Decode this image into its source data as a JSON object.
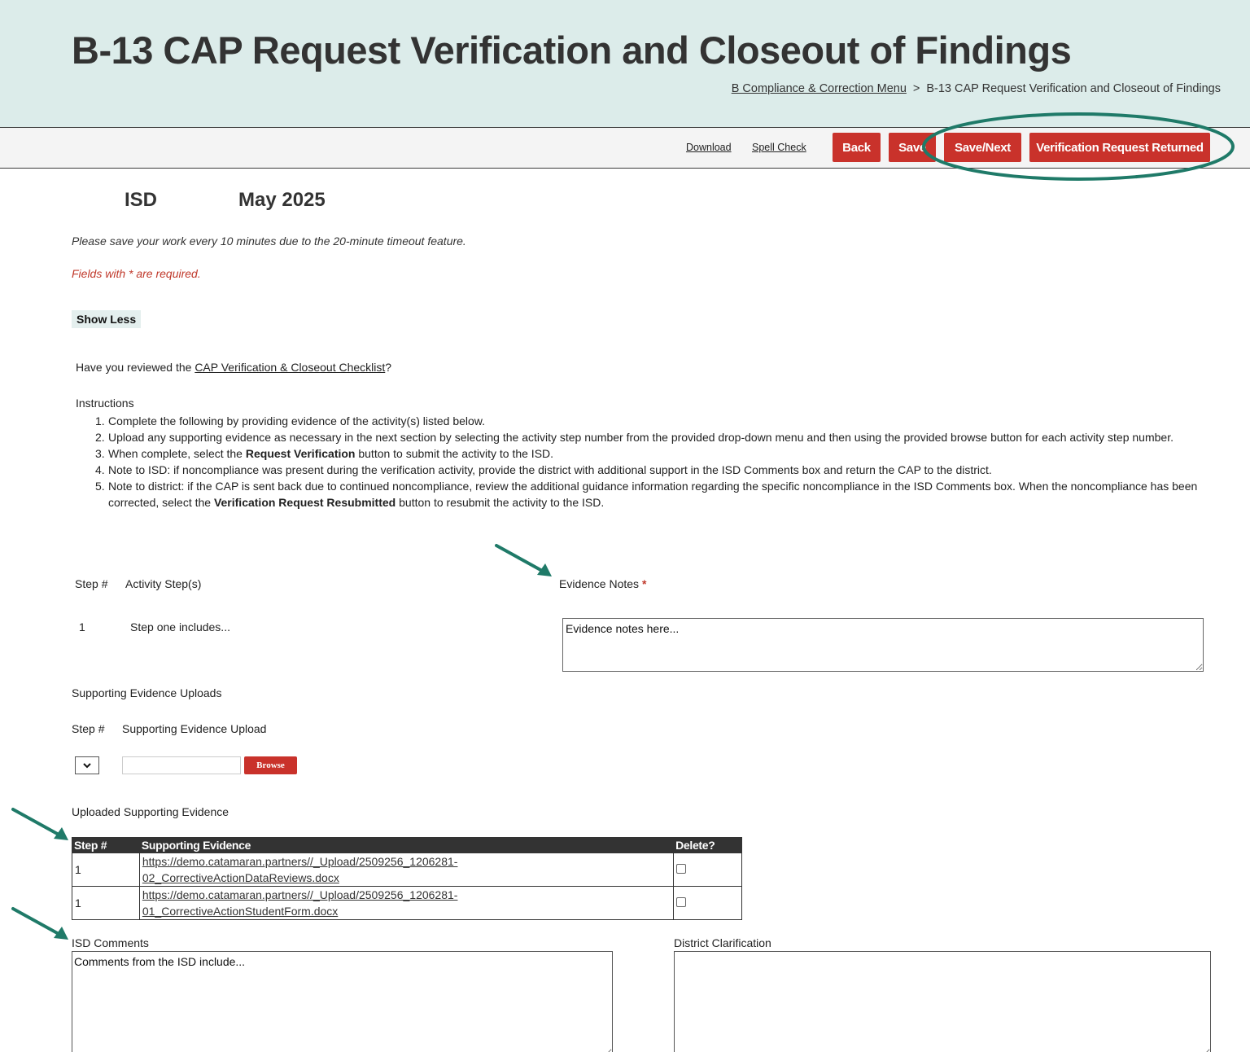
{
  "header": {
    "title": "B-13 CAP Request Verification and Closeout of Findings",
    "breadcrumb": {
      "parent": "B Compliance & Correction Menu",
      "separator": ">",
      "current": "B-13 CAP Request Verification and Closeout of Findings"
    }
  },
  "toolbar": {
    "download": "Download",
    "spell_check": "Spell Check",
    "back": "Back",
    "save": "Save",
    "save_next": "Save/Next",
    "verification_returned": "Verification Request Returned",
    "button_color": "#c9322b"
  },
  "annotation_color": "#1f7a68",
  "subheader": {
    "org": "ISD",
    "date": "May 2025"
  },
  "notes": {
    "timeout": "Please save your work every 10 minutes due to the 20-minute timeout feature.",
    "required": "Fields with * are required."
  },
  "show_less": "Show Less",
  "checklist": {
    "prefix": "Have you reviewed the ",
    "link": "CAP Verification & Closeout Checklist",
    "suffix": "?"
  },
  "instructions": {
    "title": "Instructions",
    "items": [
      {
        "num": "1.",
        "pre": "Complete the following by providing evidence of the activity(s) listed below.",
        "bold": "",
        "post": ""
      },
      {
        "num": "2.",
        "pre": "Upload any supporting evidence as necessary in the next section by selecting the activity step number from the provided drop-down menu and then using the provided browse button for each activity step number.",
        "bold": "",
        "post": ""
      },
      {
        "num": "3.",
        "pre": "When complete, select the ",
        "bold": "Request Verification",
        "post": " button to submit the activity to the ISD."
      },
      {
        "num": "4.",
        "pre": "Note to ISD: if noncompliance was present during the verification activity, provide the district with additional support in the ISD Comments box and return the CAP to the district.",
        "bold": "",
        "post": ""
      },
      {
        "num": "5.",
        "pre": "Note to district: if the CAP is sent back due to continued noncompliance, review the additional guidance information regarding the specific noncompliance in the ISD Comments box. When the noncompliance has been corrected, select the ",
        "bold": "Verification Request Resubmitted",
        "post": " button to resubmit the activity to the ISD."
      }
    ]
  },
  "activity": {
    "step_header": "Step #",
    "activity_header": "Activity Step(s)",
    "evidence_header": "Evidence Notes",
    "required_mark": "*",
    "step_num": "1",
    "step_text": "Step one includes...",
    "evidence_value": "Evidence notes here..."
  },
  "supporting": {
    "title": "Supporting Evidence Uploads",
    "step_header": "Step #",
    "upload_header": "Supporting Evidence Upload",
    "browse": "Browse"
  },
  "uploaded": {
    "title": "Uploaded Supporting Evidence",
    "headers": [
      "Step #",
      "Supporting Evidence",
      "Delete?"
    ],
    "rows": [
      {
        "step": "1",
        "line1": "https://demo.catamaran.partners//_Upload/2509256_1206281-",
        "line2": "02_CorrectiveActionDataReviews.docx"
      },
      {
        "step": "1",
        "line1": "https://demo.catamaran.partners//_Upload/2509256_1206281-",
        "line2": "01_CorrectiveActionStudentForm.docx"
      }
    ]
  },
  "comments": {
    "isd_label": "ISD Comments",
    "isd_value": "Comments from the ISD include...",
    "district_label": "District Clarification",
    "district_value": ""
  }
}
